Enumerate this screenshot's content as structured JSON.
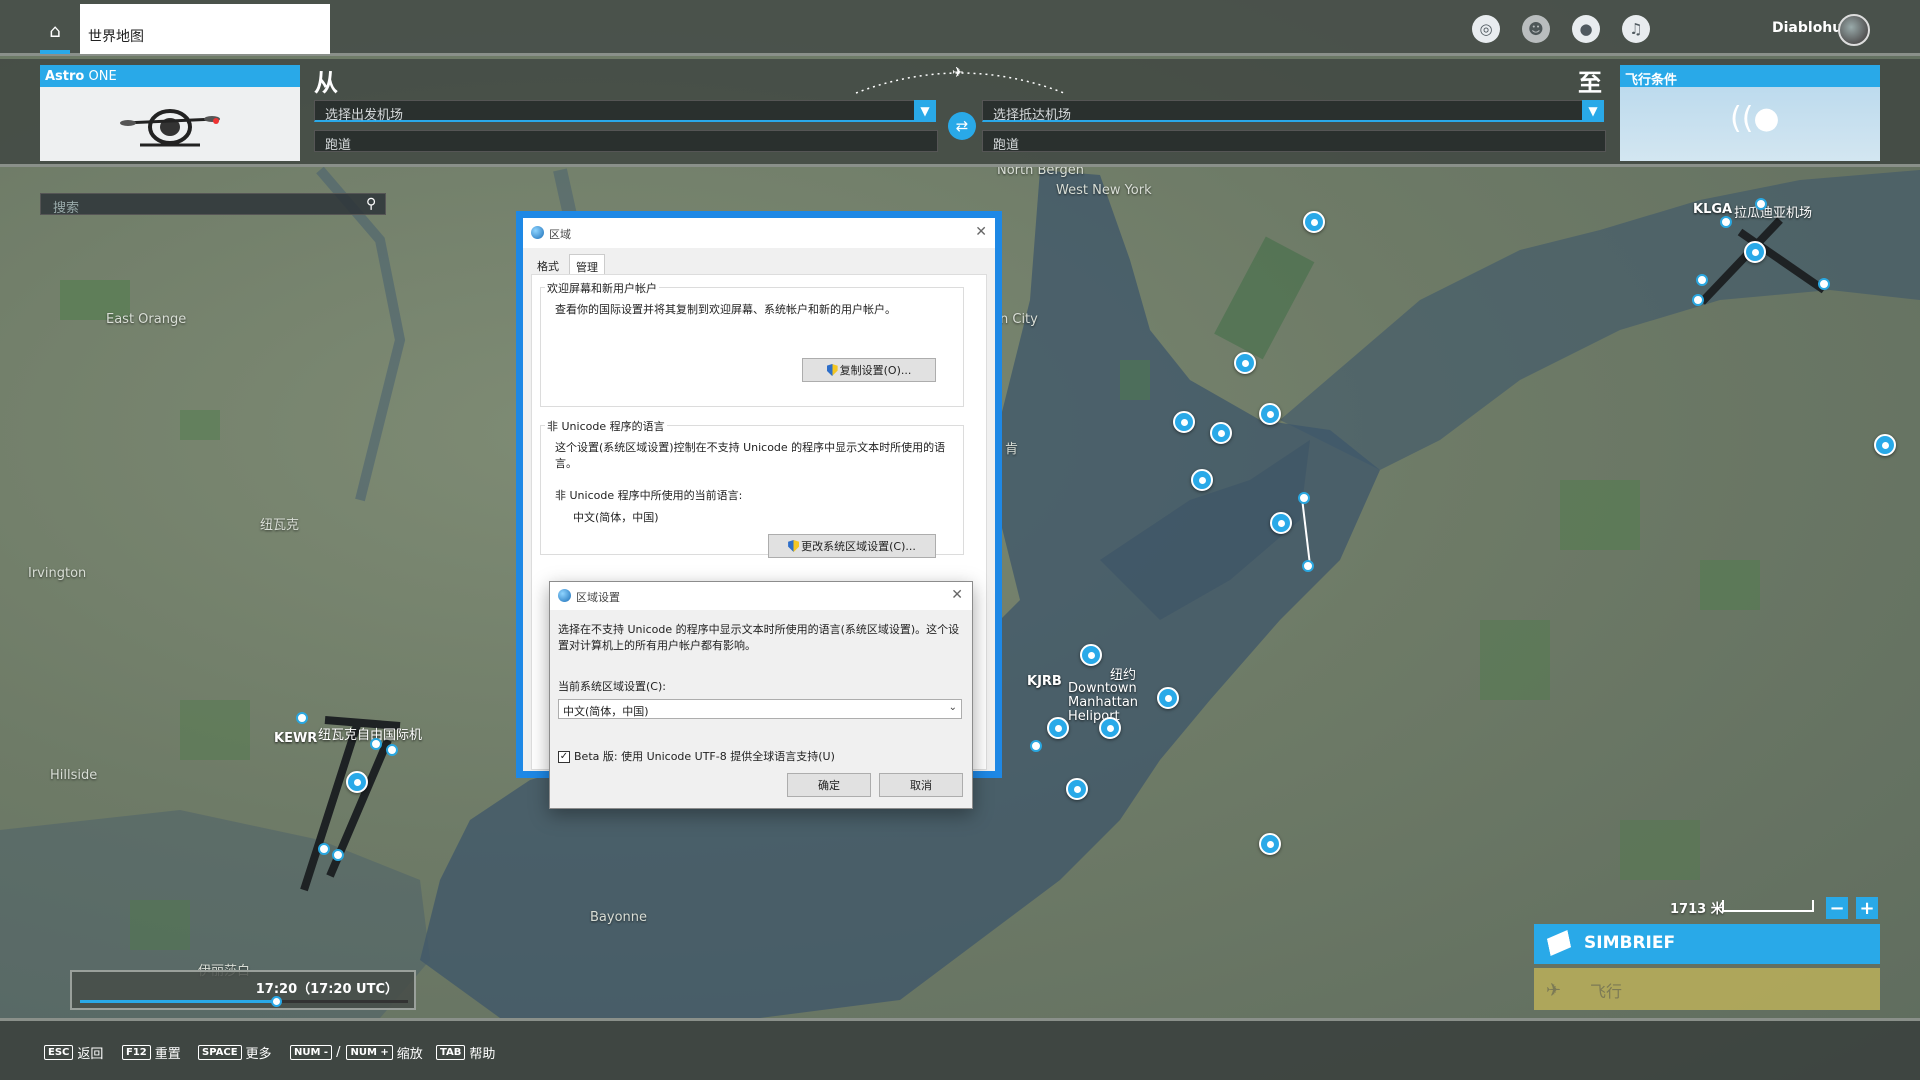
{
  "topbar": {
    "tab_title": "世界地图",
    "username": "Diablohu",
    "icons": [
      "achievements-icon",
      "friends-icon",
      "profile-icon",
      "notifications-icon"
    ]
  },
  "flight": {
    "aircraft_brand": "Astro",
    "aircraft_model": " ONE",
    "from_label": "从",
    "to_label": "至",
    "departure_placeholder": "选择出发机场",
    "arrival_placeholder": "选择抵达机场",
    "departure_runway": "跑道",
    "arrival_runway": "跑道",
    "conditions_label": "飞行条件"
  },
  "search": {
    "placeholder": "搜索"
  },
  "map": {
    "places": [
      {
        "name": "North Bergen"
      },
      {
        "name": "West New York"
      },
      {
        "name": "East Orange"
      },
      {
        "name": "纽瓦克"
      },
      {
        "name": "Irvington"
      },
      {
        "name": "Hillside"
      },
      {
        "name": "Bayonne"
      },
      {
        "name": "伊丽莎白"
      },
      {
        "name": "n City"
      },
      {
        "name": "肯"
      }
    ],
    "airports": [
      {
        "code": "KLGA",
        "name": "拉瓜迪亚机场"
      },
      {
        "code": "KEWR",
        "name": "纽瓦克自由国际机"
      },
      {
        "code": "KJRB",
        "name": "Downtown Manhattan Heliport"
      },
      {
        "code": "",
        "name": "纽约"
      }
    ]
  },
  "time": {
    "label": "17:20（17:20 UTC）",
    "progress": 0.6
  },
  "scale": {
    "label": "1713 米"
  },
  "actions": {
    "simbrief": "SIMBRIEF",
    "fly": "飞行"
  },
  "hints": [
    {
      "key": "ESC",
      "label": "返回"
    },
    {
      "key": "F12",
      "label": "重置"
    },
    {
      "key": "SPACE",
      "label": "更多"
    },
    {
      "key": "NUM -",
      "sep": "/",
      "key2": "NUM +",
      "label": "缩放"
    },
    {
      "key": "TAB",
      "label": "帮助"
    }
  ],
  "region_dialog": {
    "title": "区域",
    "tabs": [
      "格式",
      "管理"
    ],
    "welcome_group": "欢迎屏幕和新用户帐户",
    "welcome_text": "查看你的国际设置并将其复制到欢迎屏幕、系统帐户和新的用户帐户。",
    "copy_button": "复制设置(O)...",
    "unicode_group": "非 Unicode 程序的语言",
    "unicode_text": "这个设置(系统区域设置)控制在不支持 Unicode 的程序中显示文本时所使用的语言。",
    "current_lang_label": "非 Unicode 程序中所使用的当前语言:",
    "current_lang_value": "中文(简体，中国)",
    "change_button": "更改系统区域设置(C)..."
  },
  "locale_dialog": {
    "title": "区域设置",
    "description": "选择在不支持 Unicode 的程序中显示文本时所使用的语言(系统区域设置)。这个设置对计算机上的所有用户帐户都有影响。",
    "current_label": "当前系统区域设置(C):",
    "current_value": "中文(简体，中国)",
    "beta_label": "Beta 版: 使用 Unicode UTF-8 提供全球语言支持(U)",
    "beta_checked": "✓",
    "ok": "确定",
    "cancel": "取消"
  }
}
